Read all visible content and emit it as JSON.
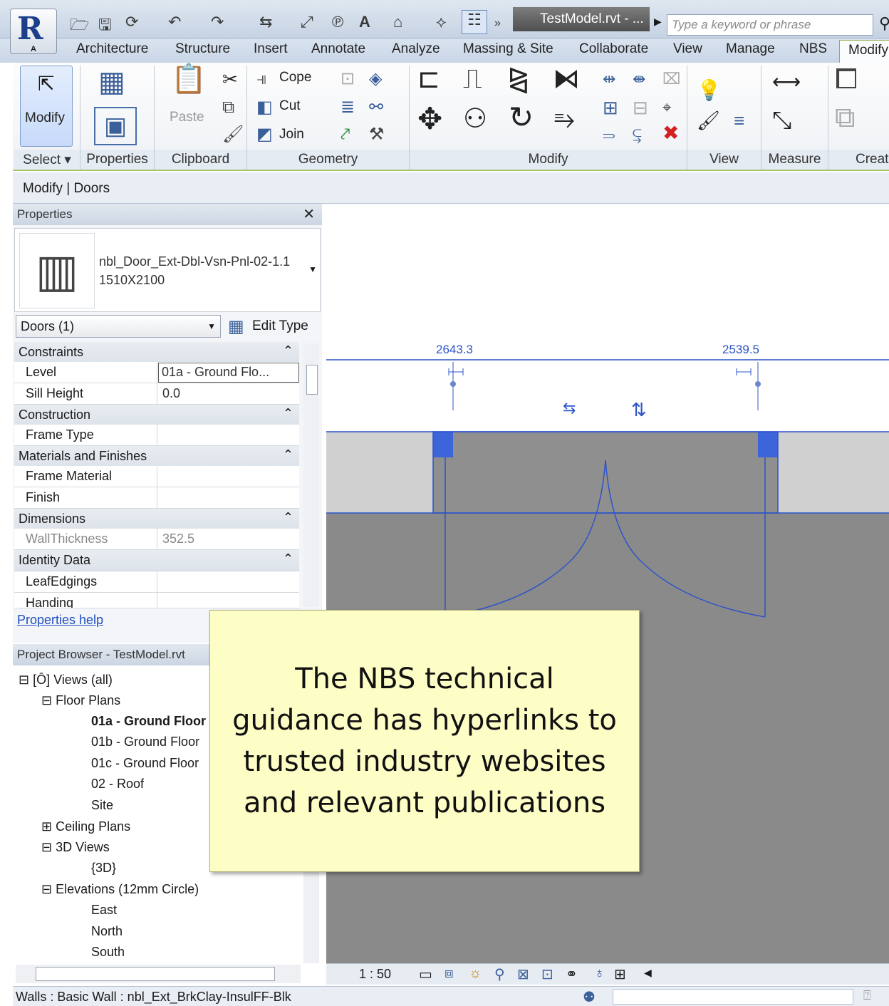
{
  "title_bar": {
    "file_title": "TestModel.rvt - ...",
    "search_placeholder": "Type a keyword or phrase",
    "app_letter": "A"
  },
  "tabs": [
    "Architecture",
    "Structure",
    "Insert",
    "Annotate",
    "Analyze",
    "Massing & Site",
    "Collaborate",
    "View",
    "Manage",
    "NBS",
    "Modify"
  ],
  "ribbon": {
    "modify_label": "Modify",
    "paste_label": "Paste",
    "cope_label": "Cope",
    "cut_label": "Cut",
    "join_label": "Join",
    "panels": [
      "Select",
      "Properties",
      "Clipboard",
      "Geometry",
      "Modify",
      "View",
      "Measure",
      "Creat"
    ]
  },
  "context_label": "Modify | Doors",
  "properties": {
    "title": "Properties",
    "type_name": "nbl_Door_Ext-Dbl-Vsn-Pnl-02-1.1",
    "type_size": "1510X2100",
    "filter": "Doors (1)",
    "edit_type": "Edit Type",
    "groups": {
      "constraints": "Constraints",
      "construction": "Construction",
      "materials": "Materials and Finishes",
      "dimensions": "Dimensions",
      "identity": "Identity Data"
    },
    "params": {
      "level_k": "Level",
      "level_v": "01a - Ground Flo...",
      "sill_k": "Sill Height",
      "sill_v": "0.0",
      "frame_type_k": "Frame Type",
      "frame_mat_k": "Frame Material",
      "finish_k": "Finish",
      "wall_k": "WallThickness",
      "wall_v": "352.5",
      "leaf_k": "LeafEdgings",
      "handing_k": "Handing"
    },
    "help_link": "Properties help"
  },
  "browser": {
    "title": "Project Browser - TestModel.rvt",
    "views_all": "Views (all)",
    "floor_plans": "Floor Plans",
    "fp1": "01a - Ground Floor",
    "fp2": "01b - Ground Floor",
    "fp3": "01c - Ground Floor",
    "fp4": "02 - Roof",
    "fp5": "Site",
    "ceiling": "Ceiling Plans",
    "views3d": "3D Views",
    "v3d": "{3D}",
    "elev": "Elevations (12mm Circle)",
    "e1": "East",
    "e2": "North",
    "e3": "South"
  },
  "drawing": {
    "dim_left": "2643.3",
    "dim_right": "2539.5",
    "scale": "1 : 50"
  },
  "status": "Walls : Basic Wall : nbl_Ext_BrkClay-InsulFF-Blk",
  "callout": "The NBS technical guidance has hyperlinks to trusted industry websites and relevant publications",
  "colors": {
    "accent": "#2d54c8",
    "callout_bg": "#fdfdc6",
    "wall": "#d0d0d0",
    "floor": "#8a8a8a"
  }
}
